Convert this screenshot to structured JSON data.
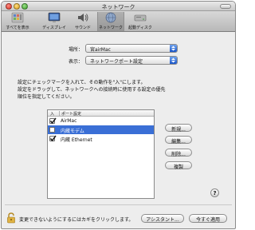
{
  "window": {
    "title": "ネットワーク"
  },
  "toolbar": {
    "items": [
      {
        "label": "すべてを表示",
        "icon": "show-all-icon"
      },
      {
        "label": "ディスプレイ",
        "icon": "display-icon"
      },
      {
        "label": "サウンド",
        "icon": "sound-icon"
      },
      {
        "label": "ネットワーク",
        "icon": "network-icon",
        "selected": true
      },
      {
        "label": "起動ディスク",
        "icon": "startup-disk-icon"
      }
    ]
  },
  "location": {
    "label": "場所：",
    "value": "宮airMac"
  },
  "show": {
    "label": "表示：",
    "value": "ネットワークポート設定"
  },
  "info_lines": [
    "設定にチェックマークを入れて、その動作を\"入\"にします。",
    "設定をドラッグして、ネットワークへの接続時に使用する設定の優先",
    "順位を指定してください。"
  ],
  "ports": {
    "headers": {
      "on": "入",
      "port": "ポート設定"
    },
    "rows": [
      {
        "name": "AirMac",
        "checked": true,
        "selected": false
      },
      {
        "name": "内蔵モデム",
        "checked": false,
        "selected": true
      },
      {
        "name": "内蔵 Ethernet",
        "checked": true,
        "selected": false
      }
    ]
  },
  "buttons": {
    "new": "新規...",
    "edit": "編集...",
    "delete": "削除...",
    "duplicate": "複製",
    "help": "?",
    "assistant": "アシスタント...",
    "apply": "今すぐ適用"
  },
  "lock_text": "変更できないようにするにはカギをクリックします。",
  "colors": {
    "selection": "#3a6fd6",
    "popup_arrow": "#1b57c9"
  }
}
